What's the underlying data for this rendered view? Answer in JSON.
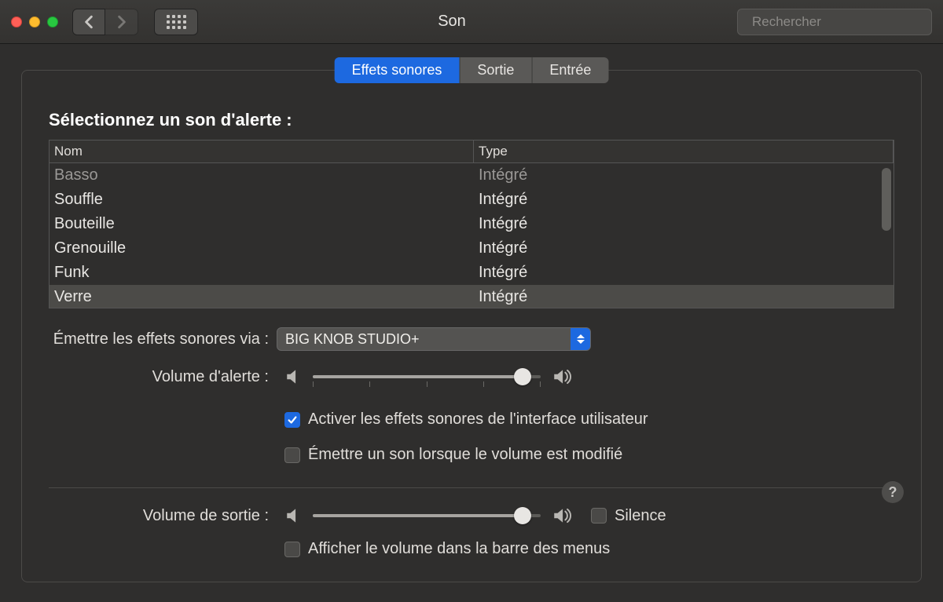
{
  "window": {
    "title": "Son",
    "search_placeholder": "Rechercher"
  },
  "tabs": {
    "effects": "Effets sonores",
    "output": "Sortie",
    "input": "Entrée"
  },
  "section_title": "Sélectionnez un son d'alerte :",
  "table": {
    "col_name": "Nom",
    "col_type": "Type",
    "rows": [
      {
        "name": "Basso",
        "type": "Intégré",
        "dim": true
      },
      {
        "name": "Souffle",
        "type": "Intégré"
      },
      {
        "name": "Bouteille",
        "type": "Intégré"
      },
      {
        "name": "Grenouille",
        "type": "Intégré"
      },
      {
        "name": "Funk",
        "type": "Intégré"
      },
      {
        "name": "Verre",
        "type": "Intégré",
        "selected": true
      }
    ]
  },
  "output_device": {
    "label": "Émettre les effets sonores via :",
    "value": "BIG KNOB STUDIO+"
  },
  "alert_volume": {
    "label": "Volume d'alerte :",
    "value_pct": 92
  },
  "check_ui_sounds": {
    "label": "Activer les effets sonores de l'interface utilisateur",
    "checked": true
  },
  "check_volume_feedback": {
    "label": "Émettre un son lorsque le volume est modifié",
    "checked": false
  },
  "output_volume": {
    "label": "Volume de sortie :",
    "value_pct": 92
  },
  "silence": {
    "label": "Silence",
    "checked": false
  },
  "show_menubar": {
    "label": "Afficher le volume dans la barre des menus",
    "checked": false
  },
  "help_glyph": "?"
}
